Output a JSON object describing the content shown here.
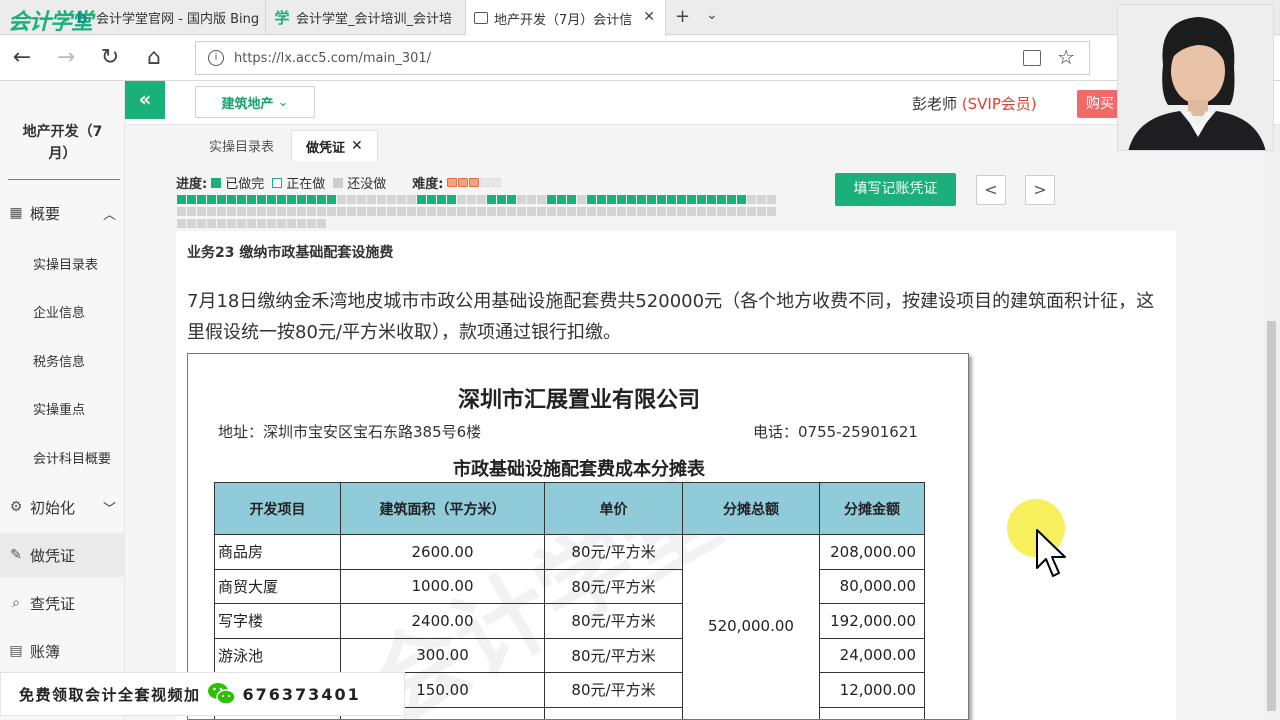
{
  "browser": {
    "brand": "会计学堂",
    "tabs": [
      {
        "label": "会计学堂官网 - 国内版 Bing"
      },
      {
        "label": "会计学堂_会计培训_会计培"
      },
      {
        "label": "地产开发（7月）会计信"
      }
    ],
    "new_tab": "+",
    "url": "https://lx.acc5.com/main_301/"
  },
  "header": {
    "industry_dropdown": "建筑地产",
    "teacher": "彭老师",
    "svip": "(SVIP会员)",
    "buy_label": "购买"
  },
  "sidebar": {
    "title": "地产开发（7月）",
    "groups": [
      {
        "label": "概要",
        "icon": "grid-icon",
        "items": [
          "实操目录表",
          "企业信息",
          "税务信息",
          "实操重点",
          "会计科目概要"
        ]
      },
      {
        "label": "初始化",
        "icon": "gear-icon"
      },
      {
        "label": "做凭证",
        "icon": "pen-icon"
      },
      {
        "label": "查凭证",
        "icon": "search-icon"
      },
      {
        "label": "账簿",
        "icon": "ledger-icon"
      }
    ]
  },
  "subtabs": [
    "实操目录表",
    "做凭证"
  ],
  "progress": {
    "label": "进度:",
    "done": "已做完",
    "doing": "正在做",
    "todo": "还没做",
    "difficulty_label": "难度:",
    "difficulty_rating": 3,
    "difficulty_max": 5,
    "cells": "ddddddddddddddddttttttttddddtttdddtttdddtddddddddddddddddtttttttttttttttttttttttttttttttttttttttttttttttttttttttttttttttttttttttttttttt",
    "colors": {
      "done": "#19b07a",
      "todo": "#d4d4d4",
      "doing": "#ffffff"
    }
  },
  "actions": {
    "fill_voucher": "填写记账凭证",
    "prev": "<",
    "next": ">"
  },
  "task": {
    "title": "业务23 缴纳市政基础配套设施费",
    "description": "7月18日缴纳金禾湾地皮城市市政公用基础设施配套费共520000元（各个地方收费不同，按建设项目的建筑面积计征，这里假设统一按80元/平方米收取），款项通过银行扣缴。"
  },
  "document": {
    "company": "深圳市汇展置业有限公司",
    "address": "地址：深圳市宝安区宝石东路385号6楼",
    "phone": "电话：0755-25901621",
    "table_title": "市政基础设施配套费成本分摊表",
    "headers": [
      "开发项目",
      "建筑面积（平方米）",
      "单价",
      "分摊总额",
      "分摊金额"
    ],
    "total_allocated": "520,000.00",
    "rows": [
      {
        "project": "商品房",
        "area": "2600.00",
        "price": "80元/平方米",
        "amount": "208,000.00"
      },
      {
        "project": "商贸大厦",
        "area": "1000.00",
        "price": "80元/平方米",
        "amount": "80,000.00"
      },
      {
        "project": "写字楼",
        "area": "2400.00",
        "price": "80元/平方米",
        "amount": "192,000.00"
      },
      {
        "project": "游泳池",
        "area": "300.00",
        "price": "80元/平方米",
        "amount": "24,000.00"
      },
      {
        "project": "",
        "area": "150.00",
        "price": "80元/平方米",
        "amount": "12,000.00"
      }
    ]
  },
  "promo": {
    "text": "免费领取会计全套视频加",
    "number": "676373401"
  }
}
